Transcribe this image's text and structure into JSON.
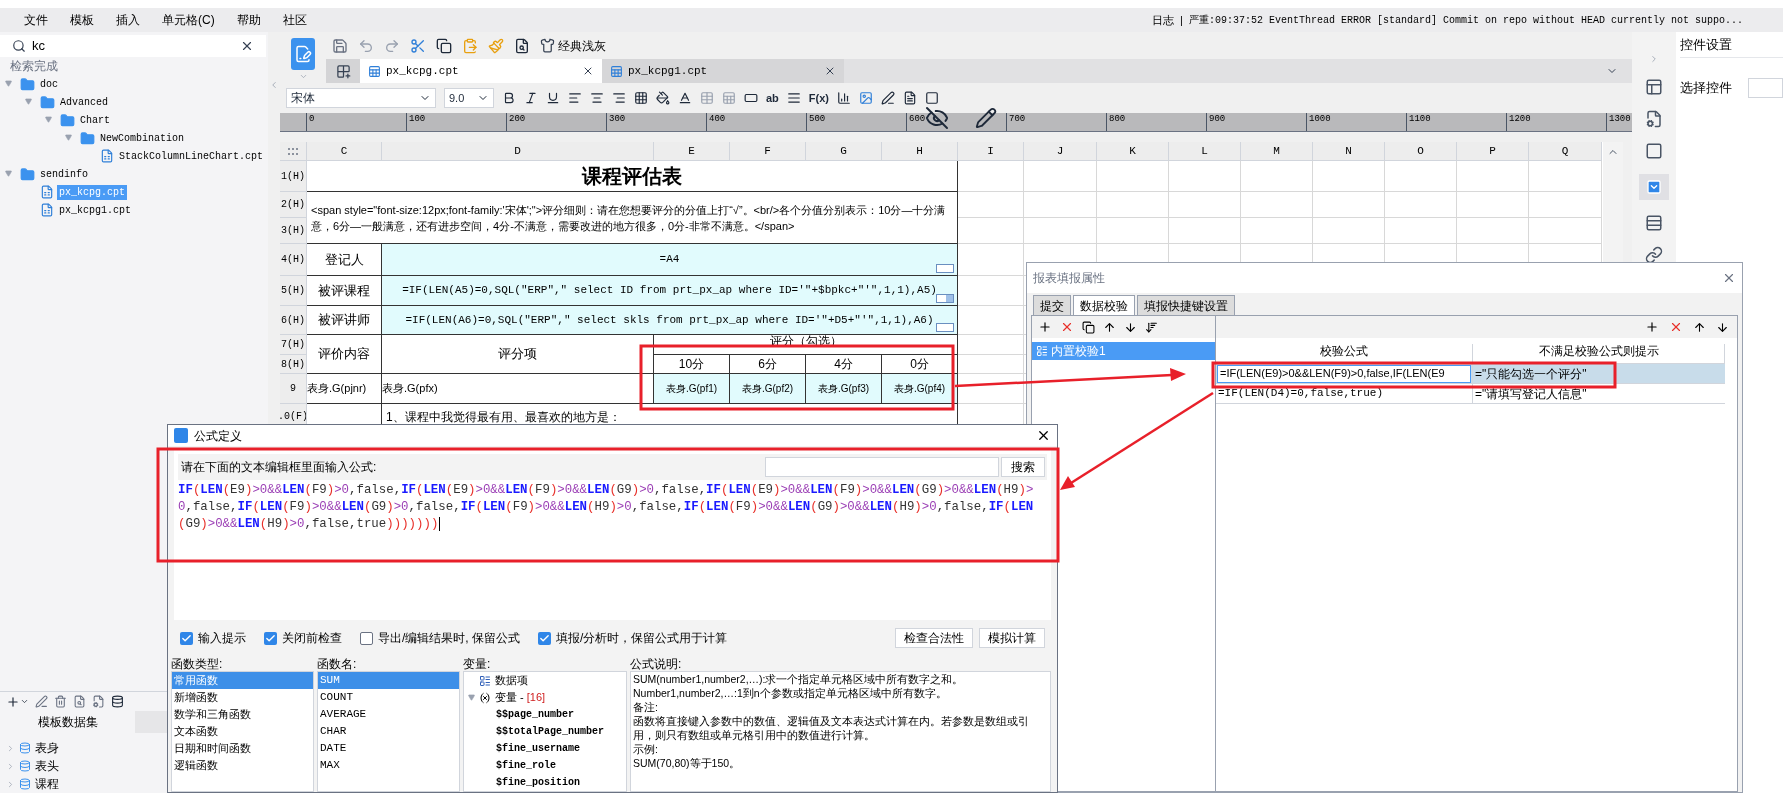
{
  "menu": [
    "文件",
    "模板",
    "插入",
    "单元格(C)",
    "帮助",
    "社区"
  ],
  "log": {
    "label": "日志",
    "separator": "|",
    "message": "严重:09:37:52 EventThread ERROR [standard] Commit on repo without HEAD currently not suppo..."
  },
  "explorer": {
    "search": {
      "value": "kc"
    },
    "status": "检索完成",
    "tree": [
      {
        "label": "doc",
        "kind": "folder",
        "expanded": true,
        "selected": false,
        "children": [
          {
            "label": "Advanced",
            "kind": "folder",
            "expanded": true,
            "selected": false,
            "children": [
              {
                "label": "Chart",
                "kind": "folder",
                "expanded": true,
                "selected": false,
                "children": [
                  {
                    "label": "NewCombination",
                    "kind": "folder",
                    "expanded": true,
                    "selected": false,
                    "children": [
                      {
                        "label": "StackColumnLineChart.cpt",
                        "kind": "file",
                        "selected": false
                      }
                    ]
                  }
                ]
              }
            ]
          }
        ]
      },
      {
        "label": "sendinfo",
        "kind": "folder",
        "expanded": true,
        "selected": false,
        "children": [
          {
            "label": "px_kcpg.cpt",
            "kind": "file",
            "selected": true
          },
          {
            "label": "px_kcpg1.cpt",
            "kind": "file",
            "selected": false
          }
        ]
      }
    ]
  },
  "datasets": {
    "tabs": [
      {
        "label": "模板数据集",
        "selected": true
      }
    ],
    "items": [
      "表身",
      "表头",
      "课程"
    ]
  },
  "toolbar": {
    "theme": "经典浅灰"
  },
  "file_tabs": [
    {
      "label": "px_kcpg.cpt",
      "selected": true
    },
    {
      "label": "px_kcpg1.cpt",
      "selected": false
    }
  ],
  "format_bar": {
    "font": "宋体",
    "size": "9.0",
    "labels": [
      "ab",
      "F(x)"
    ]
  },
  "ruler": [
    "0",
    "100",
    "200",
    "300",
    "400",
    "500",
    "600",
    "700",
    "800",
    "900",
    "1000",
    "1100",
    "1200",
    "1300"
  ],
  "sheet": {
    "columns": [
      "C",
      "D",
      "E",
      "F",
      "G",
      "H",
      "I",
      "J",
      "K",
      "L",
      "M",
      "N",
      "O",
      "P",
      "Q"
    ],
    "row_headers": [
      "1(H)",
      "2(H)",
      "3(H)",
      "4(H)",
      "5(H)",
      "6(H)",
      "7(H)",
      "8(H)",
      "9",
      ".0(F)"
    ],
    "title": "课程评估表",
    "intro": "<span style=\"font-size:12px;font-family:'宋体';\">评分细则：请在您想要评分的分值上打“√”。<br/>各个分值分别表示：10分—十分满意，6分—一般满意，还有进步空间，4分-不满意，需要改进的地方很多，0分-非常不满意。</span>",
    "fields": [
      {
        "label": "登记人",
        "formula": "=A4",
        "kind": "text"
      },
      {
        "label": "被评课程",
        "formula": "=IF(LEN(A5)=0,SQL(\"ERP\",\" select ID from prt_px_ap where ID='\"+$bpkc+\"'\",1,1),A5)",
        "kind": "combo"
      },
      {
        "label": "被评讲师",
        "formula": "=IF(LEN(A6)=0,SQL(\"ERP\",\" select skls from prt_px_ap where ID='\"+D5+\"'\",1,1),A6)",
        "kind": "text"
      }
    ],
    "score_header": {
      "content": "评价内容",
      "item": "评分项",
      "score": "评分（勾选）",
      "options": [
        "10分",
        "6分",
        "4分",
        "0分"
      ]
    },
    "data_row": {
      "content": "表身.G(pjnr)",
      "item": "表身.G(pfx)",
      "options": [
        "表身.G(pf1)",
        "表身.G(pf2)",
        "表身.G(pf3)",
        "表身.G(pf4)"
      ]
    },
    "comment": "1、课程中我觉得最有用、最喜欢的地方是："
  },
  "right_panel": {
    "title": "控件设置",
    "field_label": "选择控件"
  },
  "fill_dialog": {
    "title": "报表填报属性",
    "tabs": [
      {
        "label": "提交",
        "selected": false
      },
      {
        "label": "数据校验",
        "selected": true
      },
      {
        "label": "填报快捷键设置",
        "selected": false
      }
    ],
    "checks": [
      {
        "label": "内置校验1",
        "selected": true
      }
    ],
    "columns": [
      "校验公式",
      "不满足校验公式则提示"
    ],
    "rows": [
      {
        "formula": "=IF(LEN(E9)>0&&LEN(F9)>0,false,IF(LEN(E9",
        "message": "=\"只能勾选一个评分\"",
        "selected": true
      },
      {
        "formula": "=IF(LEN(D4)=0,false,true)",
        "message": "=\"请填写登记人信息\"",
        "selected": false
      }
    ]
  },
  "formula_dialog": {
    "title": "公式定义",
    "prompt": "请在下面的文本编辑框里面输入公式:",
    "search_button": "搜索",
    "formula": "IF(LEN(E9)>0&&LEN(F9)>0,false,IF(LEN(E9)>0&&LEN(F9)>0&&LEN(G9)>0,false,IF(LEN(E9)>0&&LEN(F9)>0&&LEN(G9)>0&&LEN(H9)>0,false,IF(LEN(F9)>0&&LEN(G9)>0,false,IF(LEN(F9)>0&&LEN(H9)>0,false,IF(LEN(F9)>0&&LEN(G9)>0&&LEN(H9)>0,false,IF(LEN(G9)>0&&LEN(H9)>0,false,true)))))))",
    "options": [
      {
        "label": "输入提示",
        "checked": true
      },
      {
        "label": "关闭前检查",
        "checked": true
      },
      {
        "label": "导出/编辑结果时, 保留公式",
        "checked": false
      },
      {
        "label": "填报/分析时，保留公式用于计算",
        "checked": true
      }
    ],
    "buttons": [
      "检查合法性",
      "模拟计算"
    ],
    "function_types": {
      "label": "函数类型:",
      "items": [
        {
          "label": "常用函数",
          "selected": true
        },
        {
          "label": "新增函数",
          "selected": false
        },
        {
          "label": "数学和三角函数",
          "selected": false
        },
        {
          "label": "文本函数",
          "selected": false
        },
        {
          "label": "日期和时间函数",
          "selected": false
        },
        {
          "label": "逻辑函数",
          "selected": false
        }
      ]
    },
    "function_names": {
      "label": "函数名:",
      "items": [
        {
          "label": "SUM",
          "selected": true
        },
        {
          "label": "COUNT",
          "selected": false
        },
        {
          "label": "AVERAGE",
          "selected": false
        },
        {
          "label": "CHAR",
          "selected": false
        },
        {
          "label": "DATE",
          "selected": false
        },
        {
          "label": "MAX",
          "selected": false
        }
      ]
    },
    "variables": {
      "label": "变量:",
      "tree": [
        {
          "label": "数据项",
          "kind": "dataset"
        },
        {
          "label": "变量 -",
          "count": "[16]",
          "kind": "group",
          "expanded": true,
          "children": [
            {
              "label": "$$page_number",
              "kind": "variable"
            },
            {
              "label": "$$totalPage_number",
              "kind": "variable"
            },
            {
              "label": "$fine_username",
              "kind": "variable"
            },
            {
              "label": "$fine_role",
              "kind": "variable"
            },
            {
              "label": "$fine_position",
              "kind": "variable"
            }
          ]
        }
      ]
    },
    "description": {
      "label": "公式说明:",
      "lines": [
        "SUM(number1,number2,…):求一个指定单元格区域中所有数字之和。",
        "Number1,number2,…:1到n个参数或指定单元格区域中所有数字。",
        "备注:",
        "函数将直接键入参数中的数值、逻辑值及文本表达式计算在内。若参数是数组或引用，则只有数组或单元格引用中的数值进行计算。",
        "示例:",
        "SUM(70,80)等于150。"
      ]
    }
  }
}
